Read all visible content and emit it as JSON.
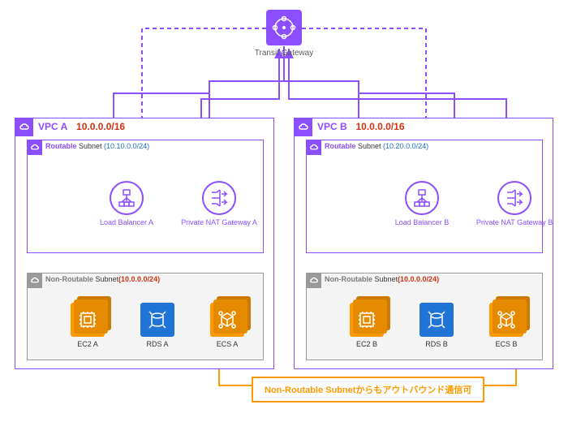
{
  "tgw": {
    "label": "Transit Gateway"
  },
  "vpc_a": {
    "name": "VPC A",
    "cidr": "10.0.0.0/16",
    "routable": {
      "label_bold": "Routable",
      "label_rest": " Subnet ",
      "cidr": "(10.10.0.0/24)"
    },
    "nonroutable": {
      "label_bold": "Non-Routable",
      "label_rest": " Subnet",
      "cidr": "(10.0.0.0/24)"
    },
    "lb": "Load Balancer A",
    "nat": "Private NAT Gateway A",
    "ec2": "EC2 A",
    "rds": "RDS A",
    "ecs": "ECS A"
  },
  "vpc_b": {
    "name": "VPC B",
    "cidr": "10.0.0.0/16",
    "routable": {
      "label_bold": "Routable",
      "label_rest": " Subnet ",
      "cidr": "(10.20.0.0/24)"
    },
    "nonroutable": {
      "label_bold": "Non-Routable",
      "label_rest": " Subnet",
      "cidr": "(10.0.0.0/24)"
    },
    "lb": "Load Balancer B",
    "nat": "Private NAT Gateway B",
    "ec2": "EC2 B",
    "rds": "RDS B",
    "ecs": "ECS B"
  },
  "callout": "Non-Routable Subnetからもアウトバウンド通信可"
}
